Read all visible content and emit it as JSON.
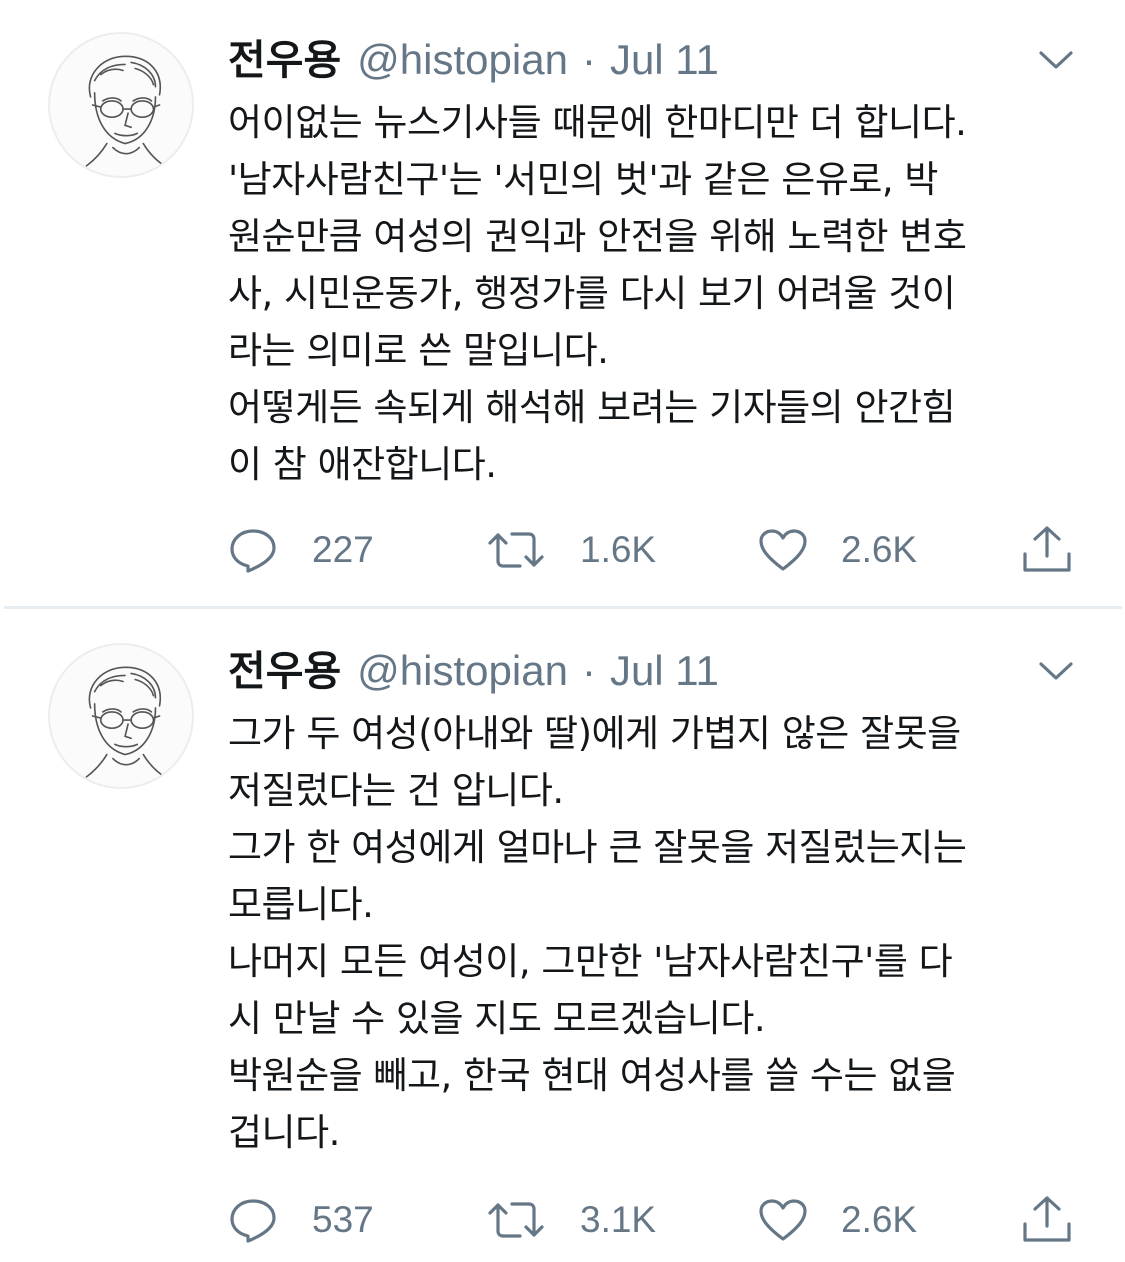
{
  "tweets": [
    {
      "author": "전우용",
      "handle": "@histopian",
      "separator": "·",
      "date": "Jul 11",
      "lines": [
        "어이없는 뉴스기사들 때문에 한마디만 더 합니다.",
        "'남자사람친구'는 '서민의 벗'과 같은 은유로, 박",
        "원순만큼 여성의 권익과 안전을 위해 노력한 변호",
        "사, 시민운동가, 행정가를 다시 보기 어려울 것이",
        "라는 의미로 쓴 말입니다.",
        "어떻게든 속되게 해석해 보려는 기자들의 안간힘",
        "이 참 애잔합니다."
      ],
      "replies": "227",
      "retweets": "1.6K",
      "likes": "2.6K"
    },
    {
      "author": "전우용",
      "handle": "@histopian",
      "separator": "·",
      "date": "Jul 11",
      "lines": [
        "그가 두 여성(아내와 딸)에게 가볍지 않은 잘못을",
        "저질렀다는 건 압니다.",
        "그가 한 여성에게 얼마나 큰 잘못을 저질렀는지는",
        "모릅니다.",
        "나머지 모든 여성이, 그만한 '남자사람친구'를 다",
        "시 만날 수 있을 지도 모르겠습니다.",
        "박원순을 빼고, 한국 현대 여성사를 쓸 수는 없을",
        "겁니다."
      ],
      "replies": "537",
      "retweets": "3.1K",
      "likes": "2.6K"
    }
  ],
  "icons": {
    "avatar": "avatar-sketch-portrait",
    "caret": "chevron-down-icon",
    "reply": "reply-icon",
    "retweet": "retweet-icon",
    "like": "heart-icon",
    "share": "share-icon"
  },
  "colors": {
    "text": "#14171a",
    "secondary": "#657786",
    "divider": "#e6ecf0",
    "background": "#ffffff"
  }
}
